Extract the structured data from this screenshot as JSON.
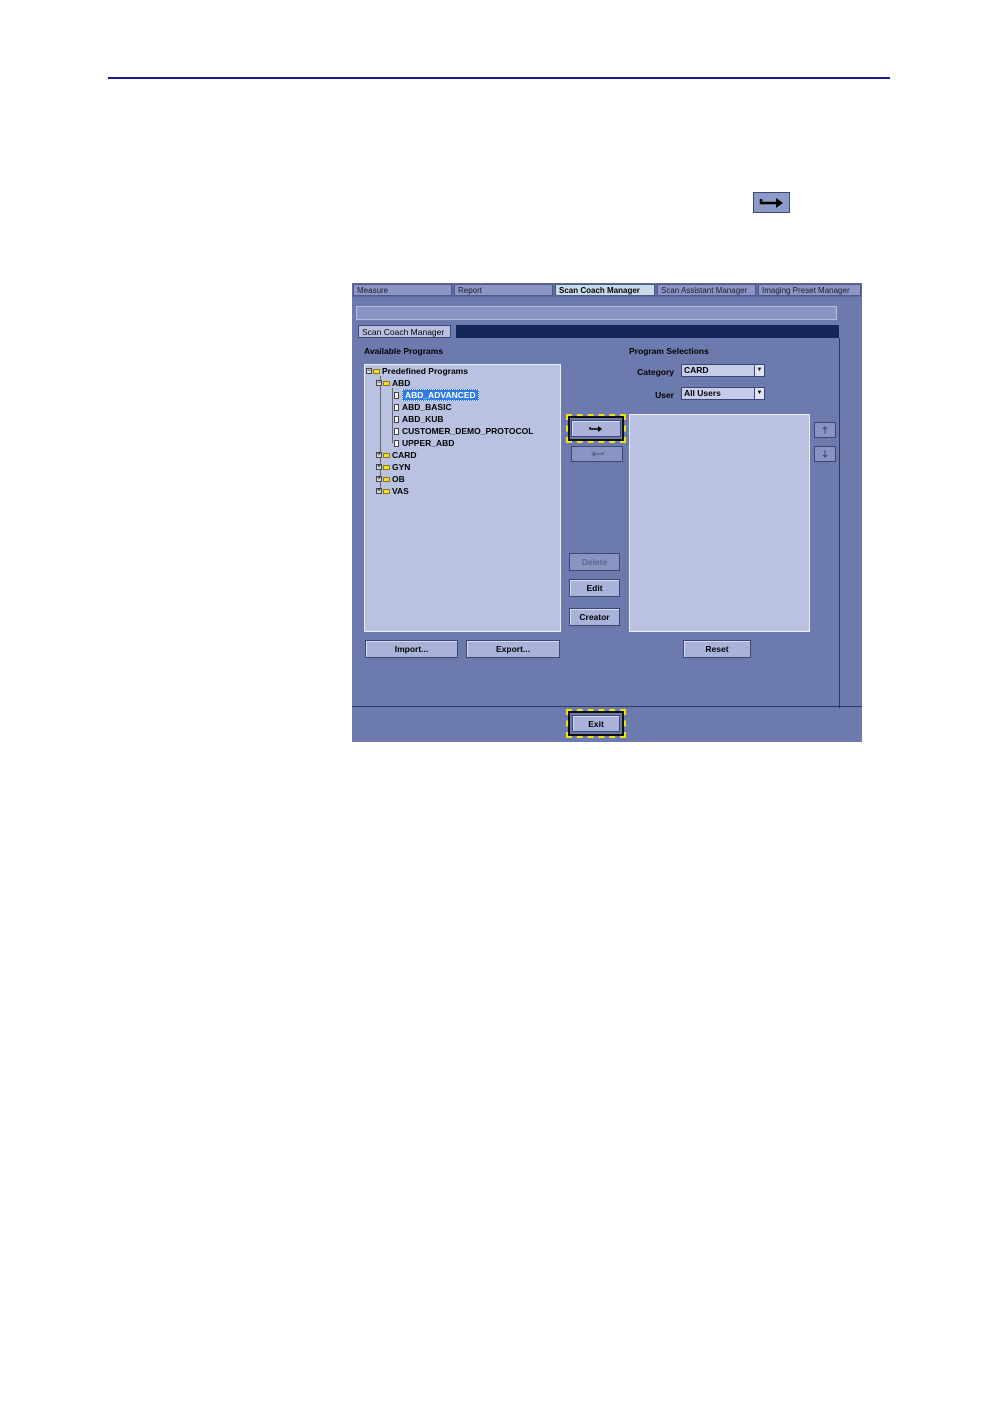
{
  "inline_icon": "right-arrow-icon",
  "tabs": [
    {
      "label": "Measure",
      "active": false
    },
    {
      "label": "Report",
      "active": false
    },
    {
      "label": "Scan Coach Manager",
      "active": true
    },
    {
      "label": "Scan Assistant Manager",
      "active": false
    },
    {
      "label": "Imaging Preset Manager",
      "active": false
    }
  ],
  "panel": {
    "title": "Scan Coach Manager",
    "available_label": "Available Programs",
    "selections_label": "Program Selections"
  },
  "tree": {
    "root": "Predefined Programs",
    "abd": "ABD",
    "abd_children": [
      "ABD_ADVANCED",
      "ABD_BASIC",
      "ABD_KUB",
      "CUSTOMER_DEMO_PROTOCOL",
      "UPPER_ABD"
    ],
    "selected": "ABD_ADVANCED",
    "collapsed": [
      "CARD",
      "GYN",
      "OB",
      "VAS"
    ]
  },
  "filters": {
    "category_label": "Category",
    "category_value": "CARD",
    "user_label": "User",
    "user_value": "All Users"
  },
  "buttons": {
    "add_icon": "right-arrow-icon",
    "remove_icon": "left-arrow-icon",
    "delete": "Delete",
    "edit": "Edit",
    "creator": "Creator",
    "import": "Import...",
    "export": "Export...",
    "reset": "Reset",
    "exit": "Exit",
    "move_up_icon": "up-arrow-icon",
    "move_down_icon": "down-arrow-icon"
  },
  "colors": {
    "screen_bg": "#6d7aae",
    "list_bg": "#b9c2e0",
    "selection": "#2f7be0",
    "highlight": "#f1e311",
    "rule": "#1a1a8c"
  }
}
